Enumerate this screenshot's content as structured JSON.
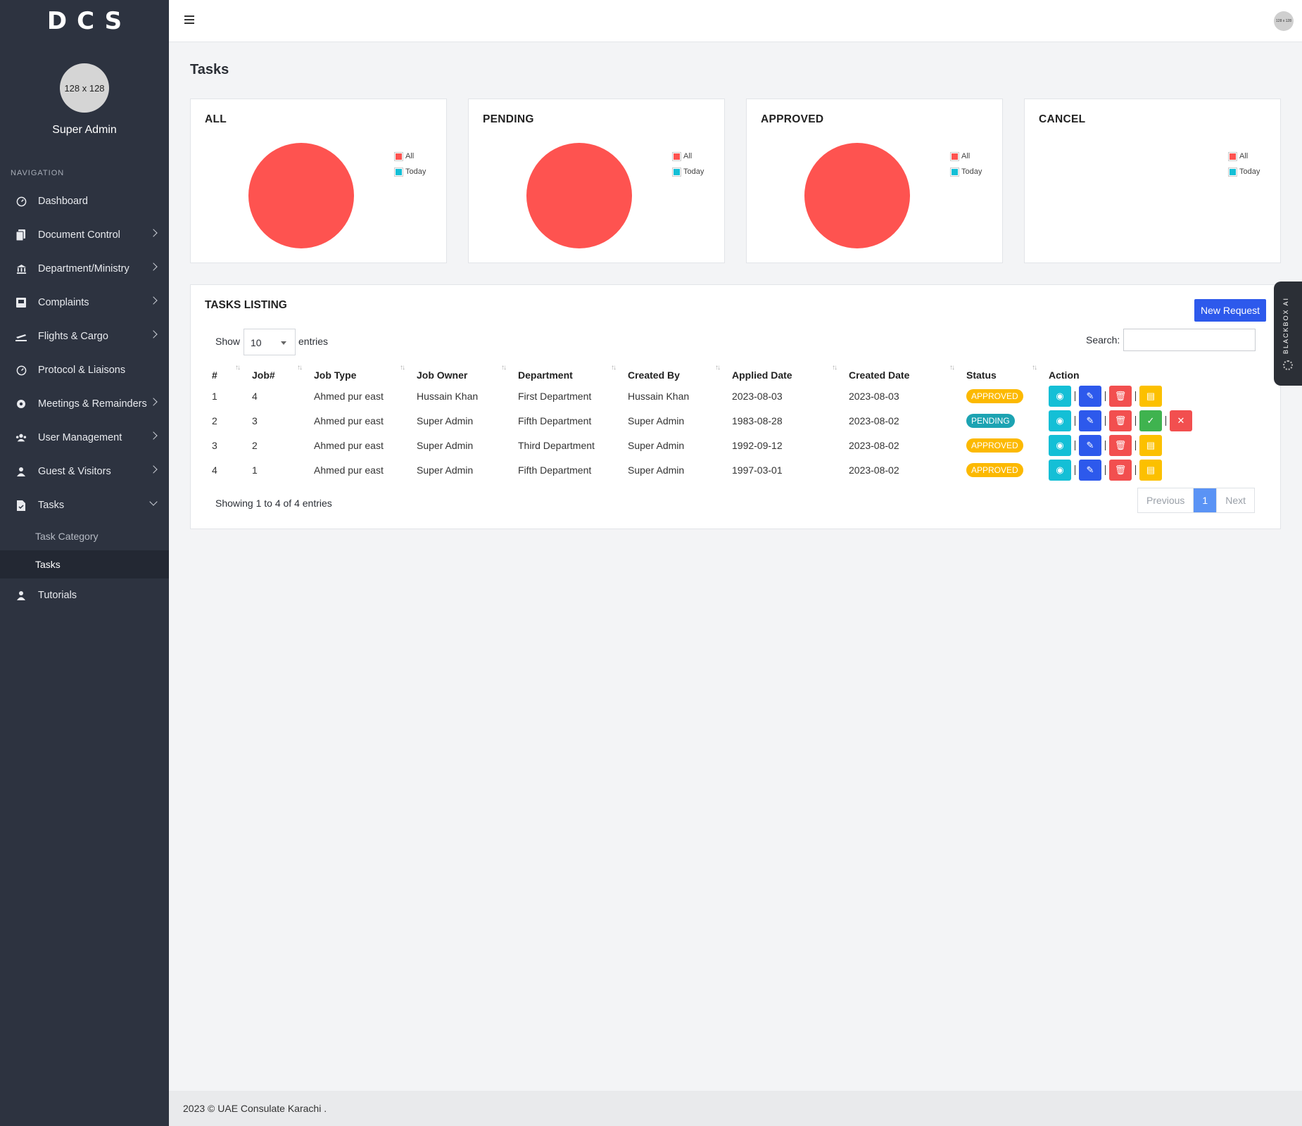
{
  "brand": "DCS",
  "profile": {
    "avatar_text": "128 x 128",
    "name": "Super Admin"
  },
  "nav": {
    "heading": "NAVIGATION",
    "items": [
      {
        "label": "Dashboard",
        "icon": "dashboard-icon"
      },
      {
        "label": "Document Control",
        "icon": "document-icon"
      },
      {
        "label": "Department/Ministry",
        "icon": "bank-icon"
      },
      {
        "label": "Complaints",
        "icon": "inbox-icon"
      },
      {
        "label": "Flights & Cargo",
        "icon": "plane-icon"
      },
      {
        "label": "Protocol & Liaisons",
        "icon": "gauge-icon"
      },
      {
        "label": "Meetings & Remainders",
        "icon": "meeting-icon"
      },
      {
        "label": "User Management",
        "icon": "users-icon"
      },
      {
        "label": "Guest & Visitors",
        "icon": "user-icon"
      },
      {
        "label": "Tasks",
        "icon": "task-file-icon"
      },
      {
        "label": "Tutorials",
        "icon": "user-icon"
      }
    ],
    "sub_items": [
      {
        "label": "Task Category"
      },
      {
        "label": "Tasks"
      }
    ]
  },
  "topbar": {
    "avatar_text": "128 x 128"
  },
  "page_title": "Tasks",
  "stat_cards": [
    {
      "title": "ALL",
      "legend_all": "All",
      "legend_today": "Today",
      "all_value": 4,
      "today_value": 0
    },
    {
      "title": "PENDING",
      "legend_all": "All",
      "legend_today": "Today",
      "all_value": 1,
      "today_value": 0
    },
    {
      "title": "APPROVED",
      "legend_all": "All",
      "legend_today": "Today",
      "all_value": 3,
      "today_value": 0
    },
    {
      "title": "CANCEL",
      "legend_all": "All",
      "legend_today": "Today",
      "all_value": 0,
      "today_value": 0
    }
  ],
  "colors": {
    "pie_all": "#fe5350",
    "pie_today": "#14bfd6",
    "approved": "#fcb900",
    "pending": "#1ca3b2",
    "primary": "#2d59ec"
  },
  "listing": {
    "title": "TASKS LISTING",
    "new_request": "New Request",
    "show_label": "Show",
    "page_size": "10",
    "entries_label": "entries",
    "search_label": "Search:",
    "search_value": "",
    "columns": [
      "#",
      "Job#",
      "Job Type",
      "Job Owner",
      "Department",
      "Created By",
      "Applied Date",
      "Created Date",
      "Status",
      "Action"
    ],
    "rows": [
      {
        "no": "1",
        "job": "4",
        "type": "Ahmed pur east",
        "owner": "Hussain Khan",
        "dept": "First Department",
        "created_by": "Hussain Khan",
        "applied": "2023-08-03",
        "created": "2023-08-03",
        "status": "APPROVED"
      },
      {
        "no": "2",
        "job": "3",
        "type": "Ahmed pur east",
        "owner": "Super Admin",
        "dept": "Fifth Department",
        "created_by": "Super Admin",
        "applied": "1983-08-28",
        "created": "2023-08-02",
        "status": "PENDING"
      },
      {
        "no": "3",
        "job": "2",
        "type": "Ahmed pur east",
        "owner": "Super Admin",
        "dept": "Third Department",
        "created_by": "Super Admin",
        "applied": "1992-09-12",
        "created": "2023-08-02",
        "status": "APPROVED"
      },
      {
        "no": "4",
        "job": "1",
        "type": "Ahmed pur east",
        "owner": "Super Admin",
        "dept": "Fifth Department",
        "created_by": "Super Admin",
        "applied": "1997-03-01",
        "created": "2023-08-02",
        "status": "APPROVED"
      }
    ],
    "showing": "Showing 1 to 4 of 4 entries",
    "pager": {
      "previous": "Previous",
      "current": "1",
      "next": "Next"
    }
  },
  "side_tab": "BLACKBOX AI",
  "footer": "2023 © UAE Consulate Karachi ."
}
